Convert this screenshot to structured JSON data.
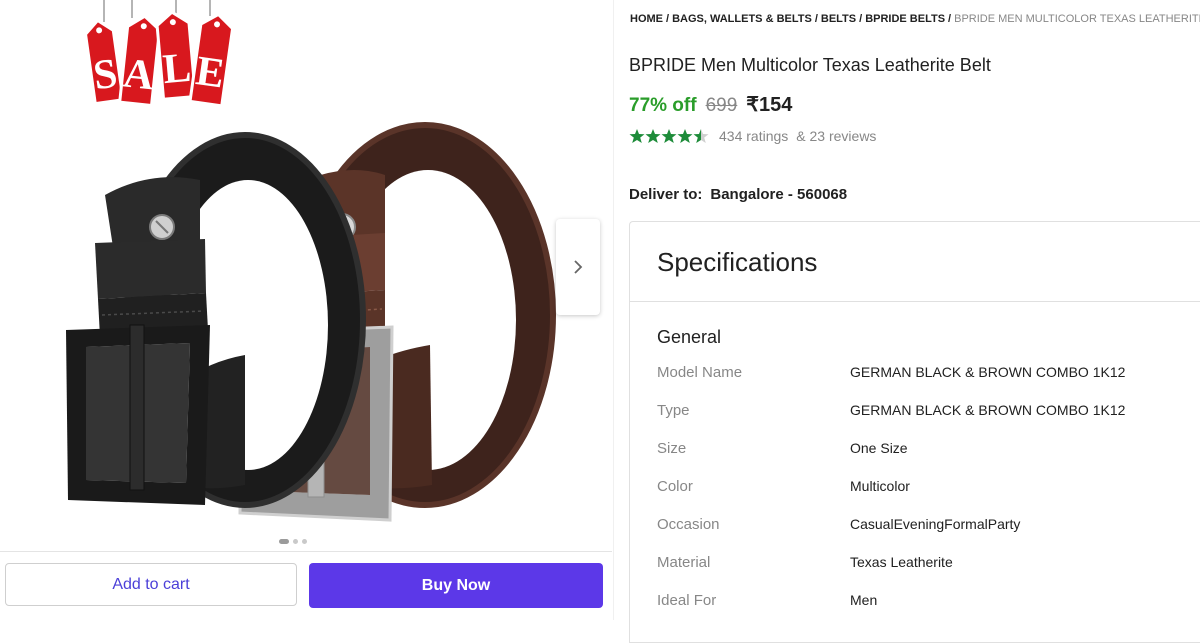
{
  "breadcrumb": {
    "items": [
      "HOME",
      "BAGS, WALLETS & BELTS",
      "BELTS",
      "BPRIDE BELTS"
    ],
    "current": "BPRIDE MEN MULTICOLOR TEXAS LEATHERITE BELT"
  },
  "product": {
    "title": "BPRIDE Men Multicolor Texas Leatherite Belt",
    "discount": "77% off",
    "mrp": "699",
    "price": "₹154",
    "rating_value": 4.5,
    "ratings_text": "434 ratings",
    "reviews_text": "& 23 reviews"
  },
  "delivery": {
    "label": "Deliver to:",
    "location": "Bangalore - 560068"
  },
  "gallery": {
    "sale_badge_letters": [
      "S",
      "A",
      "L",
      "E"
    ],
    "image_count": 3,
    "active_image": 1
  },
  "actions": {
    "add_to_cart": "Add to cart",
    "buy_now": "Buy Now"
  },
  "specifications": {
    "heading": "Specifications",
    "group": "General",
    "rows": [
      {
        "key": "Model Name",
        "value": "GERMAN BLACK & BROWN COMBO 1K12"
      },
      {
        "key": "Type",
        "value": "GERMAN BLACK & BROWN COMBO 1K12"
      },
      {
        "key": "Size",
        "value": "One Size"
      },
      {
        "key": "Color",
        "value": "Multicolor"
      },
      {
        "key": "Occasion",
        "value": "CasualEveningFormalParty"
      },
      {
        "key": "Material",
        "value": "Texas Leatherite"
      },
      {
        "key": "Ideal For",
        "value": "Men"
      }
    ]
  },
  "colors": {
    "accent": "#5c38e8",
    "discount_green": "#2a9d2a",
    "star_green": "#1e8c3a",
    "sale_red": "#d8181e"
  }
}
